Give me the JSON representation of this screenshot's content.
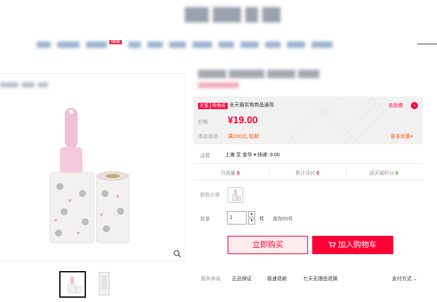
{
  "header": {
    "nav_new_badge": "NEW"
  },
  "product": {
    "coupon": {
      "tmall_tag": "天猫",
      "coupon_tag": "购物券",
      "text": "全天猫实物商品通用",
      "link": "去刮券",
      "arrow": "›"
    },
    "price_label": "价格",
    "price": "¥19.00",
    "promo_label": "本店活动",
    "promo_value": "满200元,包邮",
    "more_promo": "更多优惠",
    "shipping_label": "运费",
    "shipping_value": "上海 至 金华 ▾ 快递: 8.00",
    "stats": {
      "monthly_label": "月销量",
      "monthly_value": "0",
      "reviews_label": "累计评价",
      "reviews_value": "0",
      "points_label": "送天猫积分",
      "points_value": "9"
    },
    "color_label": "颜色分类",
    "qty_label": "数量",
    "qty_value": "1",
    "qty_up": "▴",
    "qty_down": "▾",
    "qty_unit": "件",
    "stock": "库存65件",
    "buy_now": "立即购买",
    "add_to_cart": "加入购物车",
    "service_label": "服务承诺",
    "services": [
      "正品保证",
      "极速退款",
      "七天无理由退换"
    ],
    "pay_method": "支付方式"
  },
  "icons": {
    "zoom": "search-icon",
    "cart": "cart-icon"
  },
  "colors": {
    "accent": "#ff0036",
    "promo": "#ff5b00",
    "points": "#53a524"
  }
}
